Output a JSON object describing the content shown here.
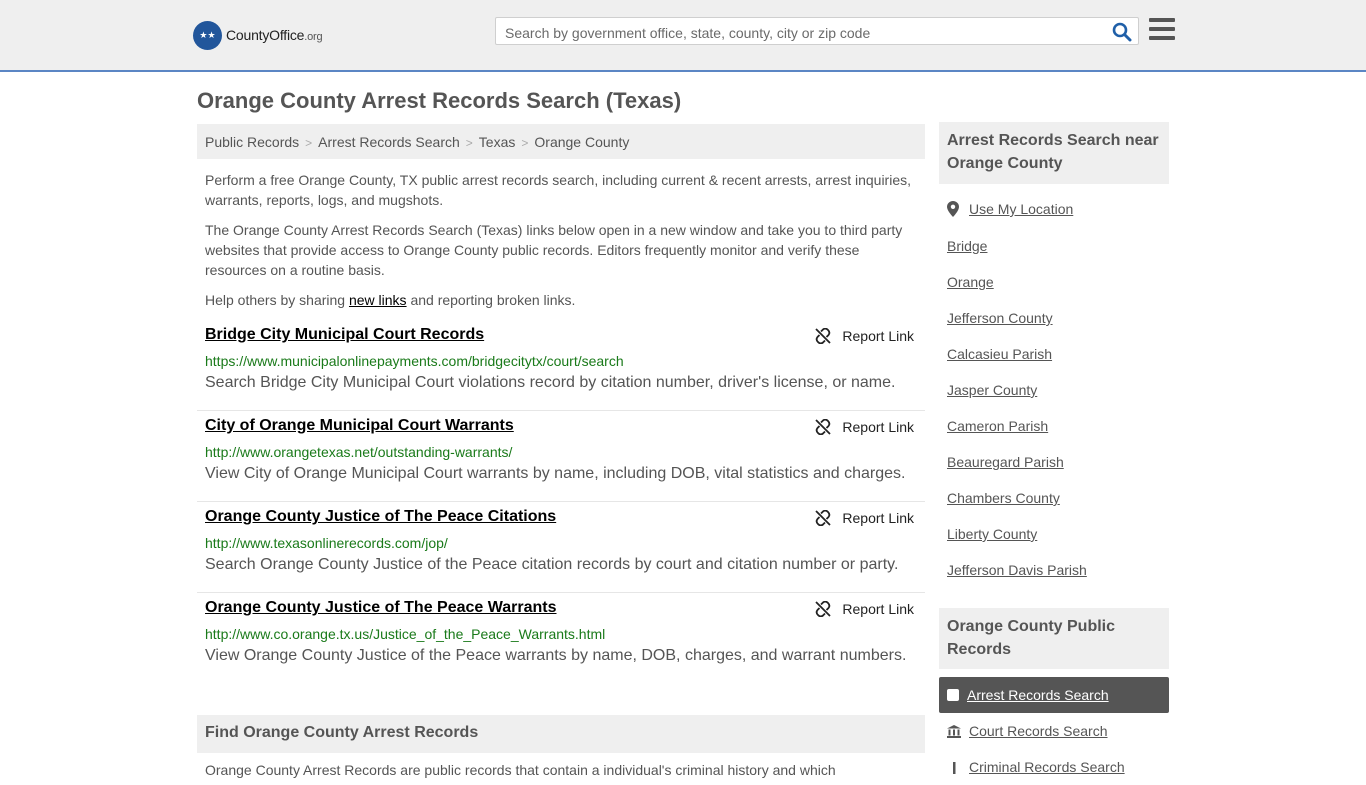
{
  "header": {
    "logo_text": "CountyOffice",
    "logo_suffix": ".org",
    "search_placeholder": "Search by government office, state, county, city or zip code"
  },
  "page_title": "Orange County Arrest Records Search (Texas)",
  "breadcrumb": [
    "Public Records",
    "Arrest Records Search",
    "Texas",
    "Orange County"
  ],
  "intro": {
    "p1": "Perform a free Orange County, TX public arrest records search, including current & recent arrests, arrest inquiries, warrants, reports, logs, and mugshots.",
    "p2": "The Orange County Arrest Records Search (Texas) links below open in a new window and take you to third party websites that provide access to Orange County public records. Editors frequently monitor and verify these resources on a routine basis.",
    "p3_before": "Help others by sharing ",
    "p3_link": "new links",
    "p3_after": " and reporting broken links."
  },
  "report_label": "Report Link",
  "entries": [
    {
      "title": "Bridge City Municipal Court Records",
      "url": "https://www.municipalonlinepayments.com/bridgecitytx/court/search",
      "desc": "Search Bridge City Municipal Court violations record by citation number, driver's license, or name."
    },
    {
      "title": "City of Orange Municipal Court Warrants",
      "url": "http://www.orangetexas.net/outstanding-warrants/",
      "desc": "View City of Orange Municipal Court warrants by name, including DOB, vital statistics and charges."
    },
    {
      "title": "Orange County Justice of The Peace Citations",
      "url": "http://www.texasonlinerecords.com/jop/",
      "desc": "Search Orange County Justice of the Peace citation records by court and citation number or party."
    },
    {
      "title": "Orange County Justice of The Peace Warrants",
      "url": "http://www.co.orange.tx.us/Justice_of_the_Peace_Warrants.html",
      "desc": "View Orange County Justice of the Peace warrants by name, DOB, charges, and warrant numbers."
    }
  ],
  "find": {
    "title": "Find Orange County Arrest Records",
    "text": "Orange County Arrest Records are public records that contain a individual's criminal history and which"
  },
  "sidebar": {
    "near_title": "Arrest Records Search near Orange County",
    "use_location": "Use My Location",
    "near_links": [
      "Bridge",
      "Orange",
      "Jefferson County",
      "Calcasieu Parish",
      "Jasper County",
      "Cameron Parish",
      "Beauregard Parish",
      "Chambers County",
      "Liberty County",
      "Jefferson Davis Parish"
    ],
    "public_title": "Orange County Public Records",
    "categories": [
      {
        "label": "Arrest Records Search",
        "icon": "checkbox-icon",
        "active": true
      },
      {
        "label": "Court Records Search",
        "icon": "courthouse-icon",
        "active": false
      },
      {
        "label": "Criminal Records Search",
        "icon": "gavel-icon",
        "active": false
      }
    ]
  },
  "colors": {
    "header_bg": "#efefef",
    "header_border": "#5b86c4",
    "url_green": "#1a7a1a",
    "search_icon": "#1f5fa8",
    "active_category_bg": "#555555"
  }
}
